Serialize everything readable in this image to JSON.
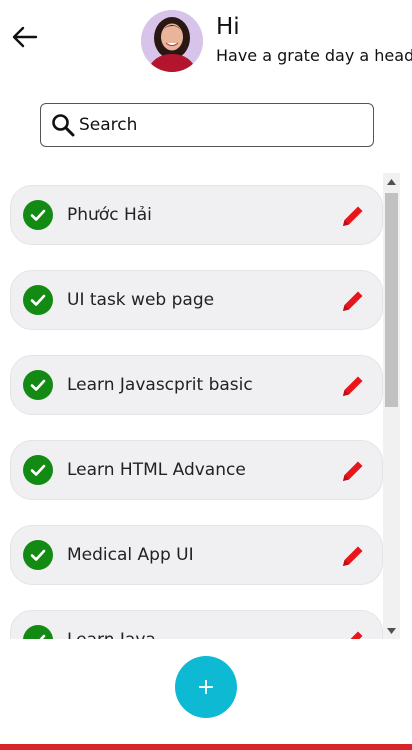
{
  "header": {
    "back_icon": "arrow-left-icon",
    "greeting": "Hi",
    "subtitle": "Have a grate day a head"
  },
  "search": {
    "placeholder": "Search",
    "icon": "search-icon"
  },
  "tasks": [
    {
      "label": "Phước Hải",
      "done": true
    },
    {
      "label": "UI task web page",
      "done": true
    },
    {
      "label": "Learn Javascprit basic",
      "done": true
    },
    {
      "label": "Learn HTML Advance",
      "done": true
    },
    {
      "label": "Medical App UI",
      "done": true
    },
    {
      "label": "Learn Java",
      "done": true
    }
  ],
  "add_button": {
    "label": "+"
  },
  "colors": {
    "check": "#138a13",
    "edit": "#e8151b",
    "accent": "#0eb9d4",
    "bottom_bar": "#d7262b"
  }
}
